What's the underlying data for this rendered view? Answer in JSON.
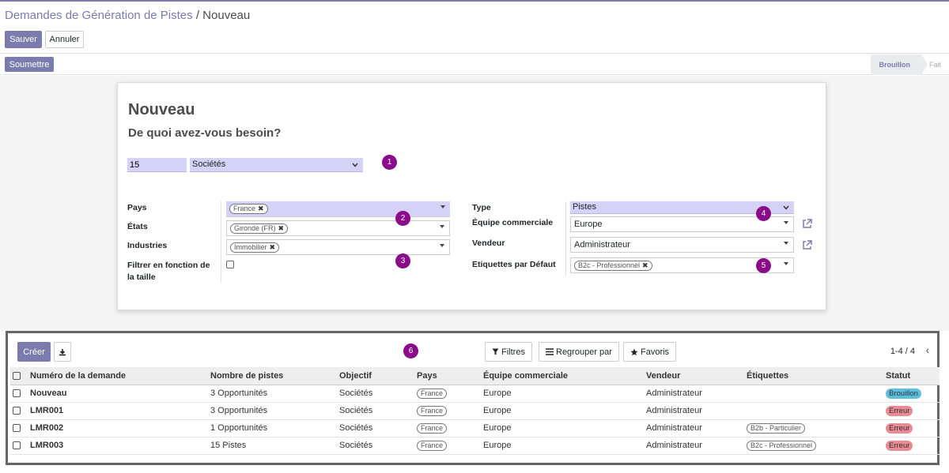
{
  "breadcrumb": {
    "parent": "Demandes de Génération de Pistes",
    "separator": " / ",
    "current": "Nouveau"
  },
  "control_panel": {
    "save_label": "Sauver",
    "cancel_label": "Annuler"
  },
  "status_bar": {
    "submit_label": "Soumettre",
    "stages": [
      {
        "label": "Brouillon",
        "active": true
      },
      {
        "label": "Fait",
        "active": false
      }
    ]
  },
  "form": {
    "title": "Nouveau",
    "question": "De quoi avez-vous besoin?",
    "quantity": "15",
    "objective": "Sociétés",
    "left": {
      "countries_label": "Pays",
      "countries_tag": "France",
      "states_label": "États",
      "states_tag": "Gironde (FR)",
      "industries_label": "Industries",
      "industries_tag": "Immobilier",
      "size_filter_label": "Filtrer en fonction de la taille"
    },
    "right": {
      "type_label": "Type",
      "type_value": "Pistes",
      "team_label": "Équipe commerciale",
      "team_value": "Europe",
      "salesperson_label": "Vendeur",
      "salesperson_value": "Administrateur",
      "tags_label": "Etiquettes par Défaut",
      "tags_tag": "B2c - Professionnel"
    }
  },
  "callouts": [
    "1",
    "2",
    "3",
    "4",
    "5",
    "6"
  ],
  "list": {
    "create_label": "Créer",
    "filters_label": "Filtres",
    "groupby_label": "Regrouper par",
    "favorites_label": "Favoris",
    "pager": "1-4 / 4",
    "columns": [
      "Numéro de la demande",
      "Nombre de pistes",
      "Objectif",
      "Pays",
      "Équipe commerciale",
      "Vendeur",
      "Étiquettes",
      "Statut"
    ],
    "rows": [
      {
        "name": "Nouveau",
        "count": "3 Opportunités",
        "objective": "Sociétés",
        "country": "France",
        "team": "Europe",
        "salesperson": "Administrateur",
        "tag": "",
        "status": "Brouillon",
        "status_kind": "draft"
      },
      {
        "name": "LMR001",
        "count": "3 Opportunités",
        "objective": "Sociétés",
        "country": "France",
        "team": "Europe",
        "salesperson": "Administrateur",
        "tag": "",
        "status": "Erreur",
        "status_kind": "err"
      },
      {
        "name": "LMR002",
        "count": "1 Opportunités",
        "objective": "Sociétés",
        "country": "France",
        "team": "Europe",
        "salesperson": "Administrateur",
        "tag": "B2b - Particulier",
        "status": "Erreur",
        "status_kind": "err"
      },
      {
        "name": "LMR003",
        "count": "15 Pistes",
        "objective": "Sociétés",
        "country": "France",
        "team": "Europe",
        "salesperson": "Administrateur",
        "tag": "B2c - Professionnel",
        "status": "Erreur",
        "status_kind": "err"
      }
    ]
  },
  "colors": {
    "brand": "#7c7bad",
    "highlight": "#d4d2f7",
    "callout": "#8b0c8b",
    "draft": "#5bc0de",
    "error": "#e88b92"
  }
}
